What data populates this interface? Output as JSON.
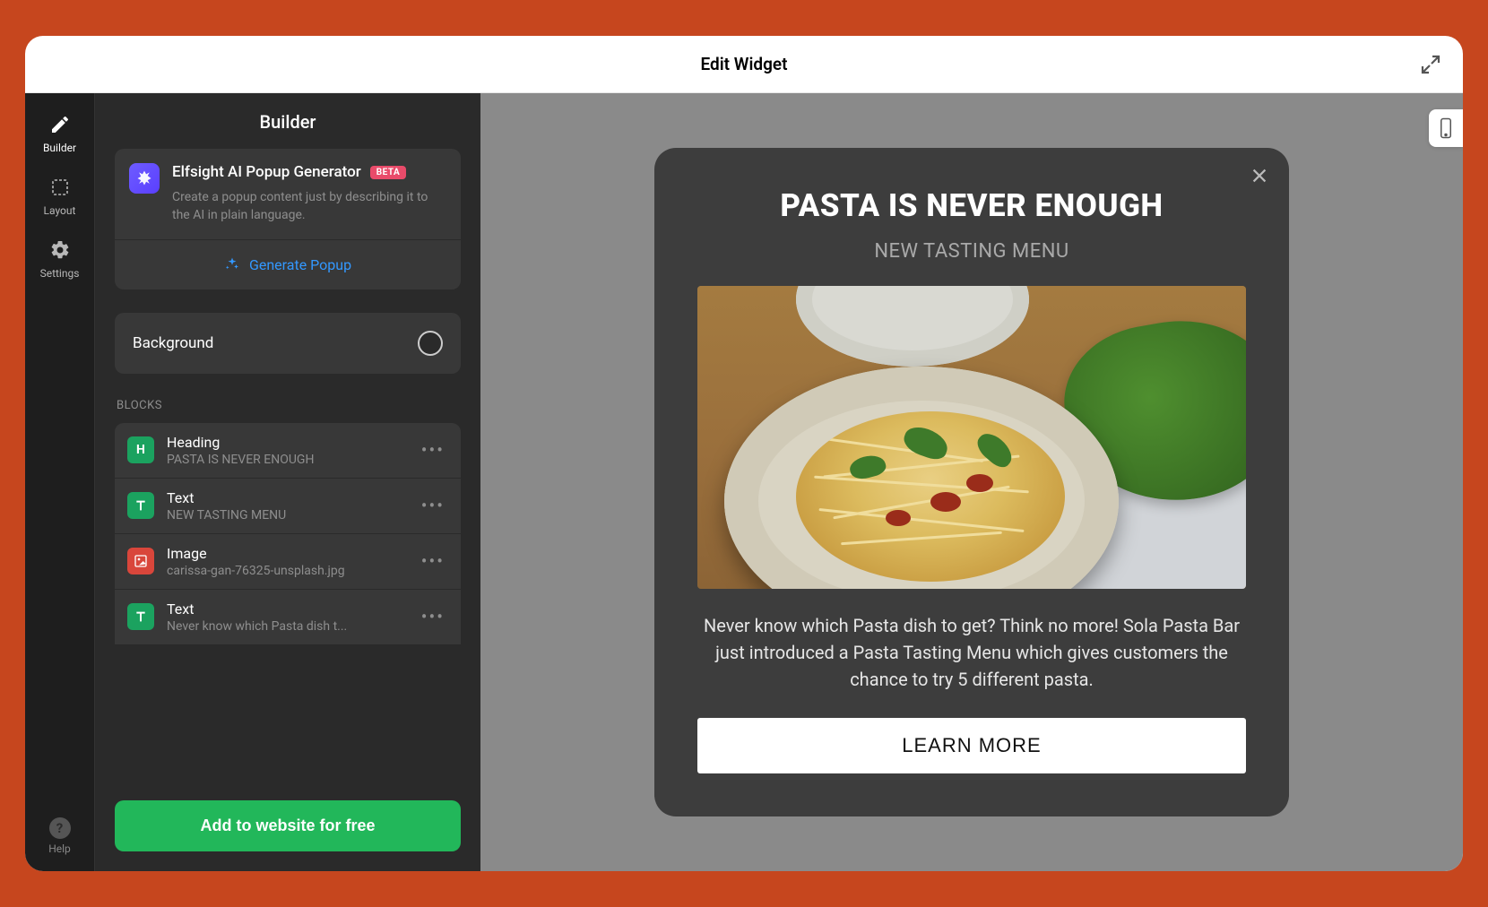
{
  "window": {
    "title": "Edit Widget"
  },
  "rail": {
    "items": [
      {
        "label": "Builder",
        "icon": "pencil"
      },
      {
        "label": "Layout",
        "icon": "layout"
      },
      {
        "label": "Settings",
        "icon": "gear"
      }
    ],
    "help_label": "Help"
  },
  "sidebar": {
    "title": "Builder",
    "ai": {
      "title": "Elfsight AI Popup Generator",
      "badge": "BETA",
      "description": "Create a popup content just by describing it to the AI in plain language.",
      "generate_label": "Generate Popup"
    },
    "background": {
      "label": "Background"
    },
    "blocks_label": "BLOCKS",
    "blocks": [
      {
        "type": "Heading",
        "subtitle": "PASTA IS NEVER ENOUGH",
        "icon": "H",
        "color": "green"
      },
      {
        "type": "Text",
        "subtitle": "NEW TASTING MENU",
        "icon": "T",
        "color": "green"
      },
      {
        "type": "Image",
        "subtitle": "carissa-gan-76325-unsplash.jpg",
        "icon": "img",
        "color": "red"
      },
      {
        "type": "Text",
        "subtitle": "Never know which Pasta dish t...",
        "icon": "T",
        "color": "green"
      }
    ],
    "add_button": "Add to website for free"
  },
  "popup": {
    "headline": "PASTA IS NEVER ENOUGH",
    "subheadline": "NEW TASTING MENU",
    "body": "Never know which Pasta dish to get? Think no more! Sola Pasta Bar just introduced a Pasta Tasting Menu which gives customers the chance to try 5 different pasta.",
    "cta": "LEARN MORE"
  }
}
